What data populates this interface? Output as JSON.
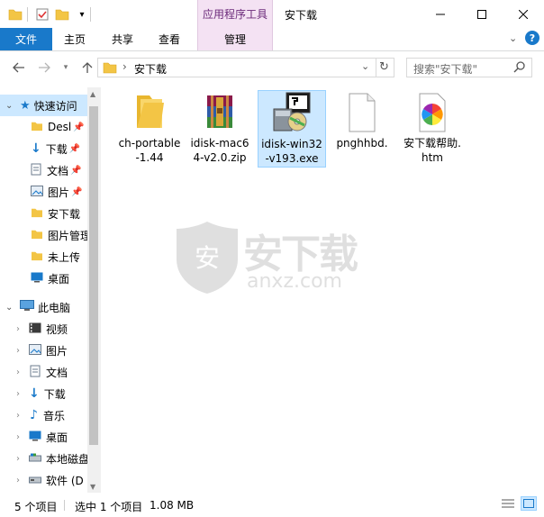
{
  "window": {
    "title": "安下载",
    "context_group": "应用程序工具"
  },
  "ribbon": {
    "tabs": [
      "文件",
      "主页",
      "共享",
      "查看",
      "管理"
    ]
  },
  "address": {
    "path": "安下载",
    "search_placeholder": "搜索\"安下载\""
  },
  "nav": {
    "quick_access": "快速访问",
    "quick_items": [
      "Desl",
      "下载",
      "文档",
      "图片",
      "安下载",
      "图片管理",
      "未上传",
      "桌面"
    ],
    "this_pc": "此电脑",
    "pc_items": [
      "视频",
      "图片",
      "文档",
      "下载",
      "音乐",
      "桌面",
      "本地磁盘",
      "软件 (D"
    ]
  },
  "files": [
    {
      "name": "ch-portable-1.44",
      "icon": "folder-icon"
    },
    {
      "name": "idisk-mac64-v2.0.zip",
      "icon": "winrar-icon"
    },
    {
      "name": "idisk-win32-v193.exe",
      "icon": "installer-icon"
    },
    {
      "name": "pnghhbd.",
      "icon": "blank-file-icon"
    },
    {
      "name": "安下载帮助.htm",
      "icon": "htm-icon"
    }
  ],
  "watermark": {
    "brand": "安下载",
    "domain": "anxz.com"
  },
  "status": {
    "count": "5 个项目",
    "selected": "选中 1 个项目",
    "size": "1.08 MB"
  },
  "colors": {
    "accent": "#1979ca",
    "selection": "#cce8ff",
    "context_tab": "#f4e2f3"
  }
}
